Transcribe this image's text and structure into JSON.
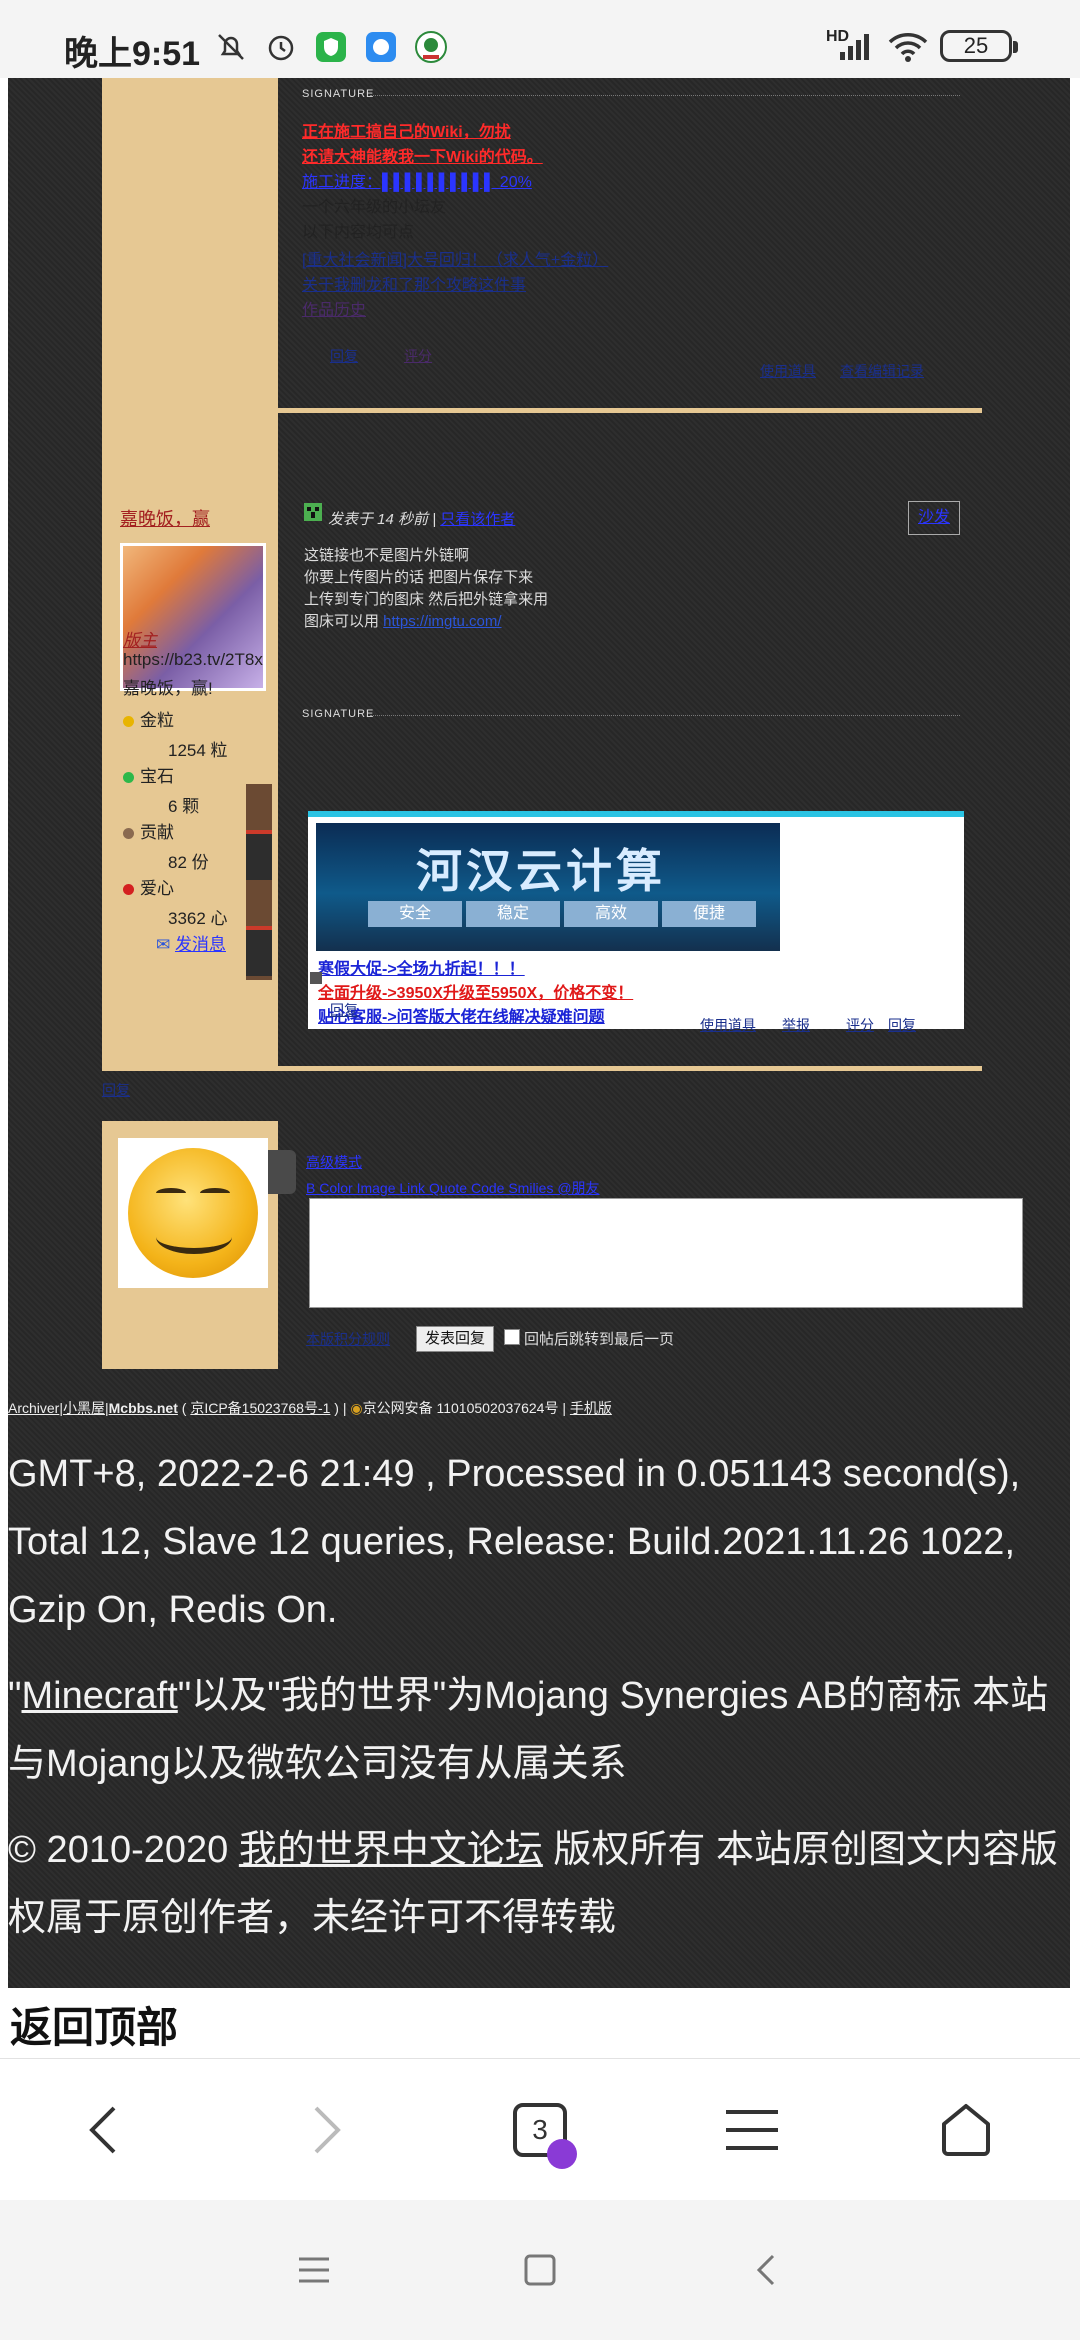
{
  "status_bar": {
    "time": "晚上9:51",
    "network": "HD",
    "battery": "25"
  },
  "post1": {
    "signature_label": "SIGNATURE",
    "lines": [
      "正在施工搞自己的Wiki，勿扰",
      "还请大神能教我一下Wiki的代码。",
      "施工进度：▌▌▌▌▌▌▌▌▌▌ 20%",
      "一个六年级的小坛友",
      "以下内容均可点",
      "[重大社会新闻]大号回归！（求人气+金粒）",
      "关于我删龙和了那个攻略这件事",
      "作品历史"
    ],
    "rate_label": "回复",
    "edit_label": "评分",
    "right_links": [
      "使用道具",
      "查看编辑记录"
    ]
  },
  "post2": {
    "username": "嘉晚饭，赢",
    "role": "版主",
    "url_fragment": "https://b23.tv/2T8x",
    "tagline": "嘉晚饭，赢!",
    "stats": [
      {
        "name": "金粒",
        "value": "1254 粒",
        "color": "#e8b400"
      },
      {
        "name": "宝石",
        "value": "6 颗",
        "color": "#2db84a"
      },
      {
        "name": "贡献",
        "value": "82 份",
        "color": "#8a6a50"
      },
      {
        "name": "爱心",
        "value": "3362 心",
        "color": "#d42020"
      }
    ],
    "message_link": "发消息",
    "meta": "发表于 14 秒前 |",
    "only_author": "只看该作者",
    "floor": "沙发",
    "body": [
      "这链接也不是图片外链啊",
      "你要上传图片的话 把图片保存下来",
      "上传到专门的图床 然后把外链拿来用",
      "图床可以用 "
    ],
    "body_link": "https://imgtu.com/",
    "signature_label": "SIGNATURE",
    "ad": {
      "title": "河汉云计算",
      "tags": [
        "安全",
        "稳定",
        "高效",
        "便捷"
      ],
      "lines": [
        "寒假大促->全场九折起！！！",
        "全面升级->3950X升级至5950X，价格不变！",
        "贴心客服->问答版大佬在线解决疑难问题"
      ]
    },
    "reply_link": "回复",
    "right_links": [
      "使用道具",
      "举报",
      "评分",
      "回复"
    ]
  },
  "reply_form": {
    "quick_label": "回复",
    "badge": "回复",
    "advanced": "高级模式",
    "toolbar": "B Color Image Link Quote Code Smilies @朋友",
    "notice": "本版积分规则",
    "submit": "发表回复",
    "checkbox_label": "回帖后跳转到最后一页"
  },
  "footer": {
    "archiver": "Archiver",
    "site": "小黑屋",
    "brand": "Mcbbs.net",
    "icp": "京ICP备15023768号-1",
    "police": "京公网安备 11010502037624号",
    "mobile": "手机版",
    "processed": "GMT+8, 2022-2-6 21:49 , Processed in 0.051143 second(s), Total 12, Slave 12 queries, Release: Build.2021.11.26 1022, Gzip On, Redis On.",
    "trademark_link": "Minecraft",
    "trademark_rest": "\"以及\"我的世界\"为Mojang Synergies AB的商标 本站与Mojang以及微软公司没有从属关系",
    "copyright_prefix": "© 2010-2020 ",
    "copyright_link": "我的世界中文论坛",
    "copyright_rest": " 版权所有 本站原创图文内容版权属于原创作者，未经许可不得转载",
    "back_top": "返回顶部"
  },
  "browser": {
    "tab_count": "3"
  }
}
